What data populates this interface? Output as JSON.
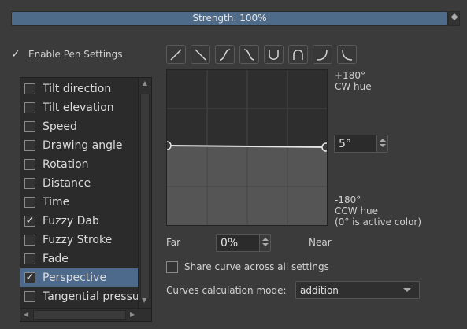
{
  "strength": {
    "label": "Strength: 100%"
  },
  "enable_pen": {
    "checked": true,
    "label": "Enable Pen Settings"
  },
  "sensors": [
    {
      "label": "Tilt direction",
      "checked": false,
      "selected": false
    },
    {
      "label": "Tilt elevation",
      "checked": false,
      "selected": false
    },
    {
      "label": "Speed",
      "checked": false,
      "selected": false
    },
    {
      "label": "Drawing angle",
      "checked": false,
      "selected": false
    },
    {
      "label": "Rotation",
      "checked": false,
      "selected": false
    },
    {
      "label": "Distance",
      "checked": false,
      "selected": false
    },
    {
      "label": "Time",
      "checked": false,
      "selected": false
    },
    {
      "label": "Fuzzy Dab",
      "checked": true,
      "selected": false
    },
    {
      "label": "Fuzzy Stroke",
      "checked": false,
      "selected": false
    },
    {
      "label": "Fade",
      "checked": false,
      "selected": false
    },
    {
      "label": "Perspective",
      "checked": true,
      "selected": true
    },
    {
      "label": "Tangential pressure",
      "checked": false,
      "selected": false
    }
  ],
  "curve_presets": [
    "linear-up-icon",
    "linear-down-icon",
    "s-curve-icon",
    "reverse-s-curve-icon",
    "u-curve-icon",
    "arch-curve-icon",
    "j-curve-icon",
    "l-curve-icon"
  ],
  "curve": {
    "top_label_1": "+180°",
    "top_label_2": "CW hue",
    "value": "5°",
    "bottom_label_1": "-180°",
    "bottom_label_2": "CCW hue",
    "bottom_label_3": "(0° is active color)",
    "far_label": "Far",
    "near_label": "Near",
    "position_value": "0%"
  },
  "share_curve": {
    "checked": false,
    "label": "Share curve across all settings"
  },
  "calc_mode": {
    "label": "Curves calculation mode:",
    "value": "addition"
  },
  "colors": {
    "accent": "#4d6a8c",
    "background": "#3b3b3b"
  }
}
